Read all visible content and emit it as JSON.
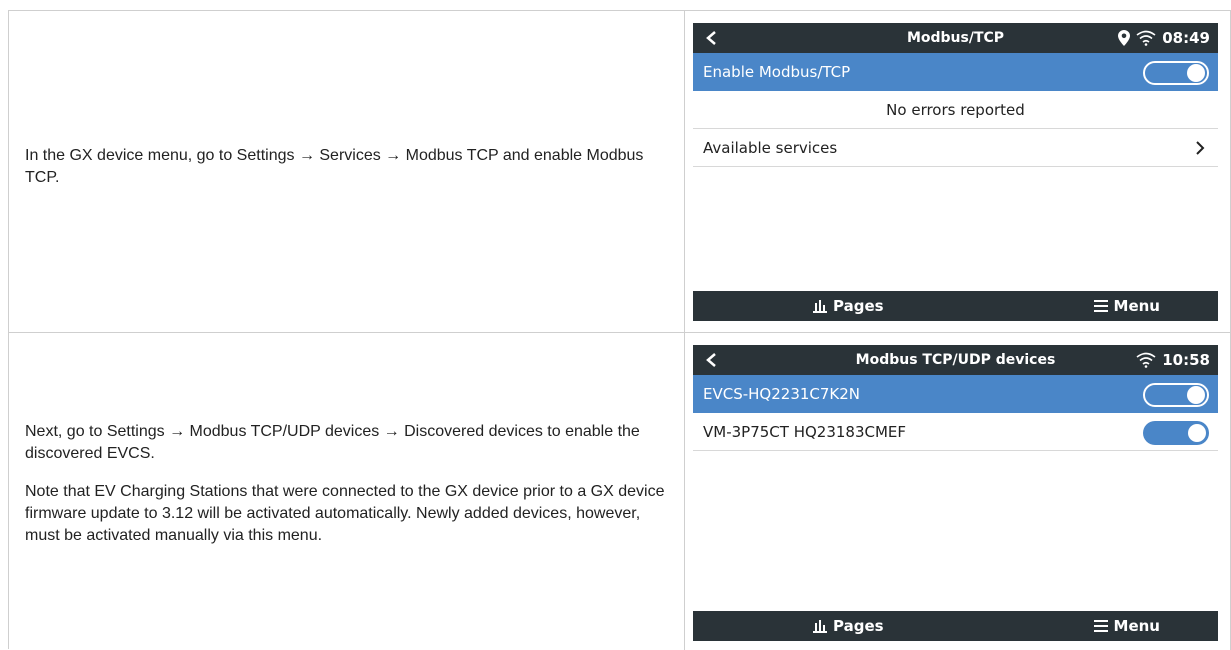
{
  "steps": [
    {
      "instruction": "In the GX device menu, go to Settings → Services → Modbus TCP and enable Modbus TCP.",
      "screen": {
        "title": "Modbus/TCP",
        "clock": "08:49",
        "rows": [
          {
            "label": "Enable Modbus/TCP",
            "toggle": "on",
            "selected": true
          },
          {
            "label": "No errors reported"
          },
          {
            "label": "Available services",
            "icon": "chevron-right-icon"
          }
        ],
        "bottom": {
          "pages": "Pages",
          "menu": "Menu"
        }
      }
    },
    {
      "instruction": "Next, go to Settings → Modbus TCP/UDP devices → Discovered devices to enable the discovered EVCS.",
      "note": "Note that EV Charging Stations that were connected to the GX device prior to a GX device firmware update to 3.12 will be activated automatically. Newly added devices, however, must be activated manually via this menu.",
      "screen": {
        "title": "Modbus TCP/UDP devices",
        "clock": "10:58",
        "rows": [
          {
            "label": "EVCS-HQ2231C7K2N",
            "toggle": "on",
            "selected": true
          },
          {
            "label": "VM-3P75CT HQ23183CMEF",
            "toggle": "on"
          }
        ],
        "bottom": {
          "pages": "Pages",
          "menu": "Menu"
        }
      }
    }
  ],
  "colors": {
    "topbar": "#2a3338",
    "selected_row": "#4a86c8",
    "toggle_on": "#4a86c8"
  }
}
